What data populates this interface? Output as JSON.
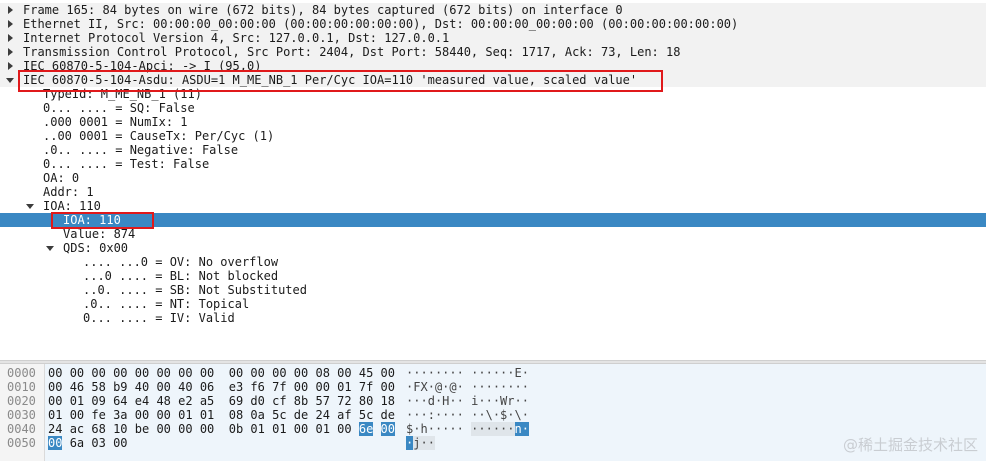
{
  "tree": [
    {
      "text": "Frame 165: 84 bytes on wire (672 bits), 84 bytes captured (672 bits) on interface 0",
      "toggle": "collapsed",
      "depth": 0
    },
    {
      "text": "Ethernet II, Src: 00:00:00_00:00:00 (00:00:00:00:00:00), Dst: 00:00:00_00:00:00 (00:00:00:00:00:00)",
      "toggle": "collapsed",
      "depth": 0
    },
    {
      "text": "Internet Protocol Version 4, Src: 127.0.0.1, Dst: 127.0.0.1",
      "toggle": "collapsed",
      "depth": 0
    },
    {
      "text": "Transmission Control Protocol, Src Port: 2404, Dst Port: 58440, Seq: 1717, Ack: 73, Len: 18",
      "toggle": "collapsed",
      "depth": 0
    },
    {
      "text": "IEC 60870-5-104-Apci: -> I (95,0)",
      "toggle": "collapsed",
      "depth": 0
    },
    {
      "text": "IEC 60870-5-104-Asdu: ASDU=1 M_ME_NB_1 Per/Cyc IOA=110 'measured value, scaled value'",
      "toggle": "expanded",
      "depth": 0
    },
    {
      "text": "TypeId: M_ME_NB_1 (11)",
      "toggle": "none",
      "depth": 1
    },
    {
      "text": "0... .... = SQ: False",
      "toggle": "none",
      "depth": 1
    },
    {
      "text": ".000 0001 = NumIx: 1",
      "toggle": "none",
      "depth": 1
    },
    {
      "text": "..00 0001 = CauseTx: Per/Cyc (1)",
      "toggle": "none",
      "depth": 1
    },
    {
      "text": ".0.. .... = Negative: False",
      "toggle": "none",
      "depth": 1
    },
    {
      "text": "0... .... = Test: False",
      "toggle": "none",
      "depth": 1
    },
    {
      "text": "OA: 0",
      "toggle": "none",
      "depth": 1
    },
    {
      "text": "Addr: 1",
      "toggle": "none",
      "depth": 1
    },
    {
      "text": "IOA: 110",
      "toggle": "expanded",
      "depth": 1
    },
    {
      "text": "IOA: 110",
      "toggle": "none",
      "depth": 2,
      "selected": true
    },
    {
      "text": "Value: 874",
      "toggle": "none",
      "depth": 2
    },
    {
      "text": "QDS: 0x00",
      "toggle": "expanded",
      "depth": 2
    },
    {
      "text": ".... ...0 = OV: No overflow",
      "toggle": "none",
      "depth": 3
    },
    {
      "text": "...0 .... = BL: Not blocked",
      "toggle": "none",
      "depth": 3
    },
    {
      "text": "..0. .... = SB: Not Substituted",
      "toggle": "none",
      "depth": 3
    },
    {
      "text": ".0.. .... = NT: Topical",
      "toggle": "none",
      "depth": 3
    },
    {
      "text": "0... .... = IV: Valid",
      "toggle": "none",
      "depth": 3
    }
  ],
  "hex": [
    {
      "offset": "0000",
      "bytes": [
        "00",
        "00",
        "00",
        "00",
        "00",
        "00",
        "00",
        "00",
        "00",
        "00",
        "00",
        "00",
        "08",
        "00",
        "45",
        "00"
      ],
      "ascii": [
        "·",
        "·",
        "·",
        "·",
        "·",
        "·",
        "·",
        "·",
        "·",
        "·",
        "·",
        "·",
        "·",
        "·",
        "E",
        "·"
      ]
    },
    {
      "offset": "0010",
      "bytes": [
        "00",
        "46",
        "58",
        "b9",
        "40",
        "00",
        "40",
        "06",
        "e3",
        "f6",
        "7f",
        "00",
        "00",
        "01",
        "7f",
        "00"
      ],
      "ascii": [
        "·",
        "F",
        "X",
        "·",
        "@",
        "·",
        "@",
        "·",
        "·",
        "·",
        "·",
        "·",
        "·",
        "·",
        "·",
        "·"
      ]
    },
    {
      "offset": "0020",
      "bytes": [
        "00",
        "01",
        "09",
        "64",
        "e4",
        "48",
        "e2",
        "a5",
        "69",
        "d0",
        "cf",
        "8b",
        "57",
        "72",
        "80",
        "18"
      ],
      "ascii": [
        "·",
        "·",
        "·",
        "d",
        "·",
        "H",
        "·",
        "·",
        "i",
        "·",
        "·",
        "·",
        "W",
        "r",
        "·",
        "·"
      ]
    },
    {
      "offset": "0030",
      "bytes": [
        "01",
        "00",
        "fe",
        "3a",
        "00",
        "00",
        "01",
        "01",
        "08",
        "0a",
        "5c",
        "de",
        "24",
        "af",
        "5c",
        "de"
      ],
      "ascii": [
        "·",
        "·",
        "·",
        ":",
        "·",
        "·",
        "·",
        "·",
        "·",
        "·",
        "\\",
        "·",
        "$",
        "·",
        "\\",
        "·"
      ]
    },
    {
      "offset": "0040",
      "bytes": [
        "24",
        "ac",
        "68",
        "10",
        "be",
        "00",
        "00",
        "00",
        "0b",
        "01",
        "01",
        "00",
        "01",
        "00",
        "6e",
        "00"
      ],
      "ascii": [
        "$",
        "·",
        "h",
        "·",
        "·",
        "·",
        "·",
        "·",
        "·",
        "·",
        "·",
        "·",
        "·",
        "·",
        "n",
        "·"
      ]
    },
    {
      "offset": "0050",
      "bytes": [
        "00",
        "6a",
        "03",
        "00"
      ],
      "ascii": [
        "·",
        "j",
        "·",
        "·"
      ]
    }
  ],
  "watermark": "@稀土掘金技术社区"
}
